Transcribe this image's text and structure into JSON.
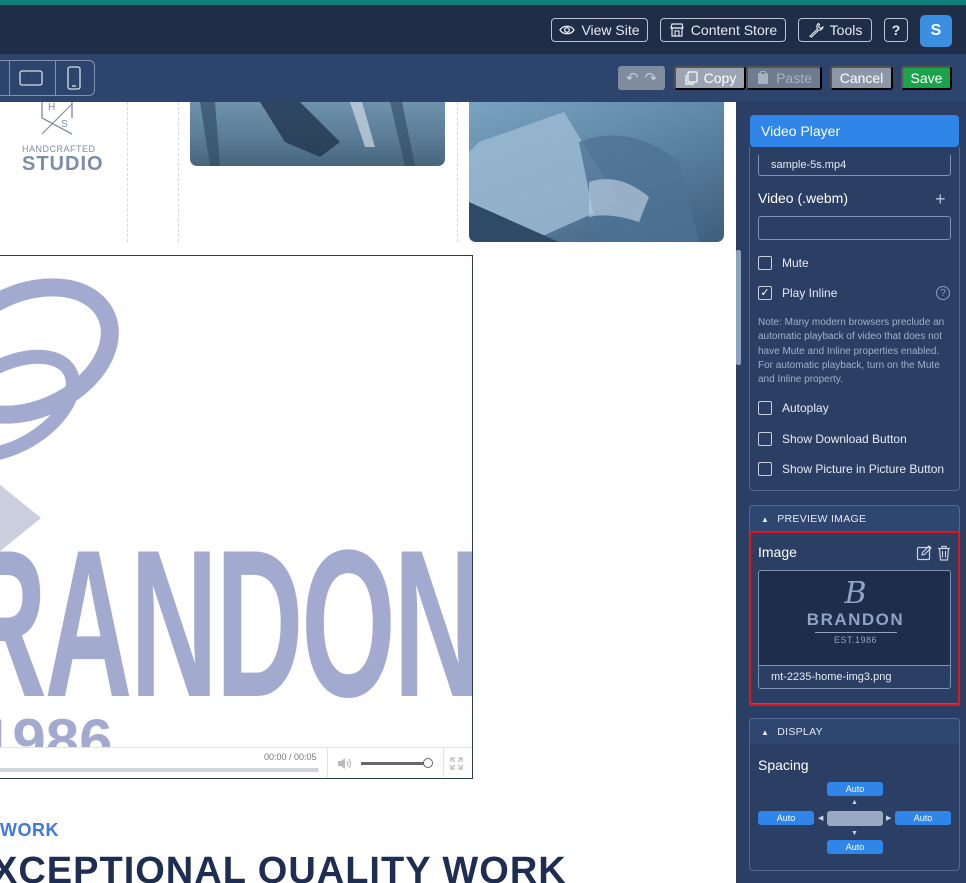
{
  "topbar": {
    "view_site": "View Site",
    "content_store": "Content Store",
    "tools": "Tools",
    "help": "?",
    "avatar": "S"
  },
  "toolbar": {
    "copy": "Copy",
    "paste": "Paste",
    "cancel": "Cancel",
    "save": "Save"
  },
  "canvas": {
    "studio_logo": {
      "monogram_top": "H",
      "monogram_bottom": "S",
      "sub": "HANDCRAFTED",
      "main": "STUDIO"
    },
    "video": {
      "time": "00:00 / 00:05",
      "poster_letters": "RANDON",
      "poster_year": "1986"
    },
    "work_label": "WORK",
    "work_heading": "XCEPTIONAL QUALITY WORK"
  },
  "panel": {
    "title": "Video Player",
    "mp4_value": "sample-5s.mp4",
    "webm_label": "Video (.webm)",
    "webm_value": "",
    "mute_label": "Mute",
    "play_inline_label": "Play Inline",
    "note": "Note: Many modern browsers preclude an automatic playback of video that does not have Mute and Inline properties enabled. For automatic playback, turn on the Mute and Inline property.",
    "autoplay_label": "Autoplay",
    "download_label": "Show Download Button",
    "pip_label": "Show Picture in Picture Button",
    "checkboxes": {
      "mute": false,
      "play_inline": true,
      "autoplay": false,
      "download": false,
      "pip": false
    },
    "preview_section": "PREVIEW IMAGE",
    "image_label": "Image",
    "image_logo": {
      "letter": "B",
      "name": "BRANDON",
      "est": "EST.1986"
    },
    "image_filename": "mt-2235-home-img3.png",
    "display_section": "DISPLAY",
    "spacing_label": "Spacing",
    "spacing": {
      "top": "Auto",
      "left": "Auto",
      "right": "Auto",
      "bottom": "Auto"
    }
  },
  "colors": {
    "topbar_bg": "#1f2d47",
    "toolbar_bg": "#2d456c",
    "panel_bg": "#2a3f63",
    "accent_blue": "#2f86e8",
    "save_green": "#1aa34a",
    "highlight_red": "#e0161b"
  }
}
